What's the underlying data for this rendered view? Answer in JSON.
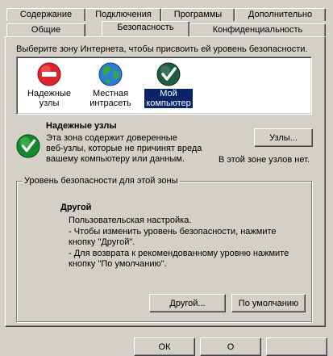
{
  "tabs_row_back": [
    {
      "label": "Содержание"
    },
    {
      "label": "Подключения"
    },
    {
      "label": "Программы"
    },
    {
      "label": "Дополнительно"
    }
  ],
  "tabs_row_front": [
    {
      "label": "Общие"
    },
    {
      "label": "Безопасность",
      "active": true
    },
    {
      "label": "Конфиденциальность"
    }
  ],
  "zone_prompt": "Выберите зону Интернета, чтобы присвоить ей уровень безопасности.",
  "zones": [
    {
      "line1": "Надежные",
      "line2": "узлы",
      "icon": "no-entry-icon",
      "color": "#e0242c"
    },
    {
      "line1": "Местная",
      "line2": "интрасеть",
      "icon": "globe-icon",
      "color": "#2a7fd4"
    },
    {
      "line1": "Мой",
      "line2": "компьютер",
      "icon": "checkmark-icon",
      "color": "#1f5b3e",
      "selected": true
    }
  ],
  "zone_info": {
    "title": "Надежные узлы",
    "desc_line1": "Эта зона содержит доверенные",
    "desc_line2": "веб-узлы, которые не причинят вреда",
    "desc_line3": "вашему компьютеру или данным.",
    "sites_button": "Узлы...",
    "sites_status": "В этой зоне узлов нет.",
    "icon": "checkmark-icon",
    "icon_color": "#128a2c"
  },
  "security_level": {
    "legend": "Уровень безопасности для этой зоны",
    "heading": "Другой",
    "line1": "Пользовательская настройка.",
    "line2": "- Чтобы изменить уровень безопасности, нажмите",
    "line3": "кнопку \"Другой\".",
    "line4": "- Для возврата к рекомендованному уровню нажмите",
    "line5": "кнопку \"По умолчанию\".",
    "custom_button": "Другой...",
    "default_button": "По умолчанию"
  },
  "footer": {
    "ok_label": "ОК",
    "cancel_label": "О"
  }
}
